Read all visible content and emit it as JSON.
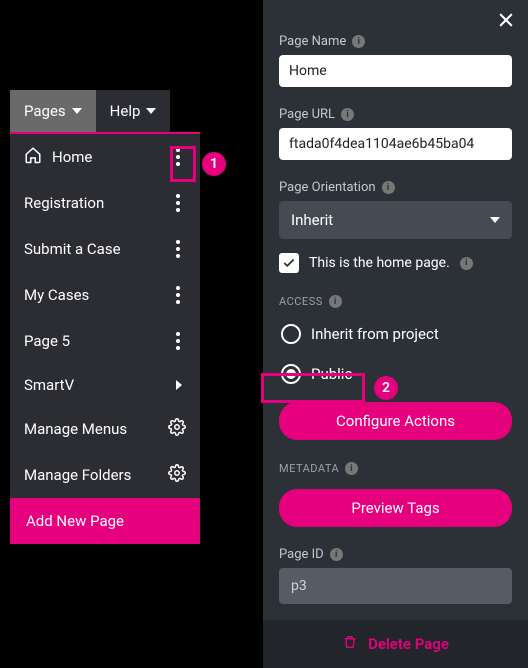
{
  "tabs": {
    "pages": "Pages",
    "help": "Help"
  },
  "sidebar": {
    "items": [
      {
        "label": "Home"
      },
      {
        "label": "Registration"
      },
      {
        "label": "Submit a Case"
      },
      {
        "label": "My Cases"
      },
      {
        "label": "Page 5"
      },
      {
        "label": "SmartV"
      }
    ],
    "manage_menus": "Manage Menus",
    "manage_folders": "Manage Folders",
    "add_new_page": "Add New Page"
  },
  "callouts": {
    "one": "1",
    "two": "2"
  },
  "panel": {
    "page_name_label": "Page Name",
    "page_name_value": "Home",
    "page_url_label": "Page URL",
    "page_url_value": "ftada0f4dea1104ae6b45ba04",
    "orientation_label": "Page Orientation",
    "orientation_value": "Inherit",
    "homepage_check": "This is the home page.",
    "access_header": "ACCESS",
    "access_inherit": "Inherit from project",
    "access_public": "Public",
    "configure_actions": "Configure Actions",
    "metadata_header": "METADATA",
    "preview_tags": "Preview Tags",
    "page_id_label": "Page ID",
    "page_id_value": "p3",
    "delete_page": "Delete Page"
  }
}
